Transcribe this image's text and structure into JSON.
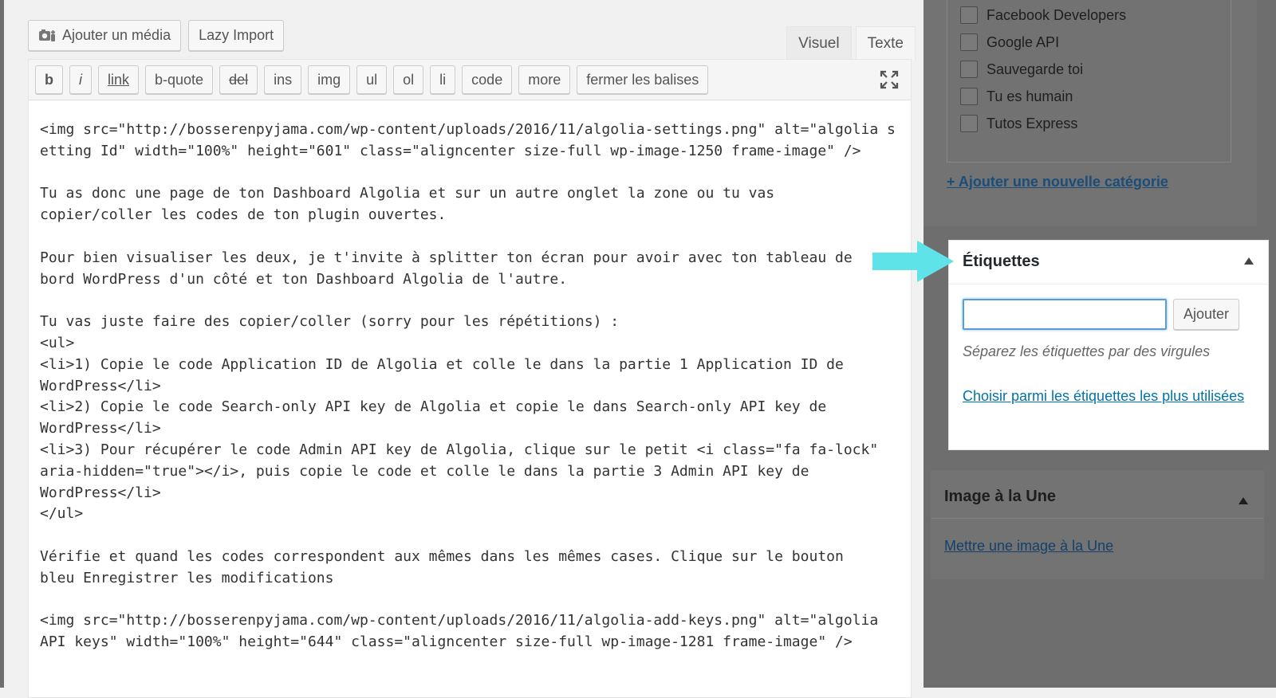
{
  "toolbar": {
    "add_media_label": "Ajouter un média",
    "lazy_import_label": "Lazy Import"
  },
  "editor_tabs": [
    "Visuel",
    "Texte"
  ],
  "quicktags": [
    "b",
    "i",
    "link",
    "b-quote",
    "del",
    "ins",
    "img",
    "ul",
    "ol",
    "li",
    "code",
    "more",
    "fermer les balises"
  ],
  "editor": {
    "content": "<img src=\"http://bosserenpyjama.com/wp-content/uploads/2016/11/algolia-settings.png\" alt=\"algolia setting Id\" width=\"100%\" height=\"601\" class=\"aligncenter size-full wp-image-1250 frame-image\" />\n\nTu as donc une page de ton Dashboard Algolia et sur un autre onglet la zone ou tu vas\ncopier/coller les codes de ton plugin ouvertes.\n\nPour bien visualiser les deux, je t'invite à splitter ton écran pour avoir avec ton tableau de\nbord WordPress d'un côté et ton Dashboard Algolia de l'autre.\n\nTu vas juste faire des copier/coller (sorry pour les répétitions) :\n<ul>\n<li>1) Copie le code Application ID de Algolia et colle le dans la partie 1 Application ID de\nWordPress</li>\n<li>2) Copie le code Search-only API key de Algolia et copie le dans Search-only API key de\nWordPress</li>\n<li>3) Pour récupérer le code Admin API key de Algolia, clique sur le petit <i class=\"fa fa-lock\"\naria-hidden=\"true\"></i>, puis copie le code et colle le dans la partie 3 Admin API key de\nWordPress</li>\n</ul>\n\nVérifie et quand les codes correspondent aux mêmes dans les mêmes cases. Clique sur le bouton\nbleu Enregistrer les modifications\n\n<img src=\"http://bosserenpyjama.com/wp-content/uploads/2016/11/algolia-add-keys.png\" alt=\"algolia\nAPI keys\" width=\"100%\" height=\"644\" class=\"aligncenter size-full wp-image-1281 frame-image\" />"
  },
  "categories": {
    "items": [
      "Facebook Developers",
      "Google API",
      "Sauvegarde toi",
      "Tu es humain",
      "Tutos Express"
    ],
    "add_link": "+ Ajouter une nouvelle catégorie"
  },
  "tags": {
    "title": "Étiquettes",
    "input_value": "",
    "add_label": "Ajouter",
    "hint": "Séparez les étiquettes par des virgules",
    "choose_link": "Choisir parmi les étiquettes les plus utilisées"
  },
  "featured": {
    "title": "Image à la Une",
    "link": "Mettre une image à la Une"
  },
  "colors": {
    "overlay_gray": "#6e6e6e",
    "highlight_arrow": "#5ee3e8",
    "link_blue": "#0073aa",
    "focus_blue": "#5b9dd9"
  }
}
